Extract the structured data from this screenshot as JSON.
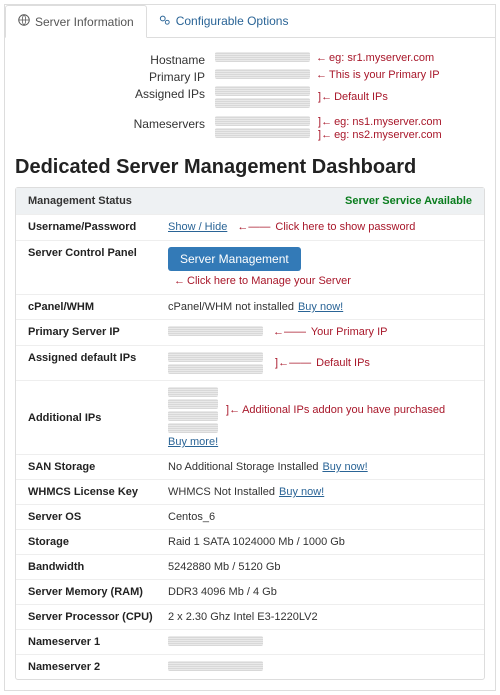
{
  "tabs": {
    "server_info": "Server Information",
    "config_options": "Configurable Options"
  },
  "fields": {
    "hostname": {
      "label": "Hostname",
      "annot": "eg: sr1.myserver.com"
    },
    "primary_ip": {
      "label": "Primary IP",
      "annot": "This is your Primary IP"
    },
    "assigned_ips": {
      "label": "Assigned IPs",
      "annot": "Default IPs"
    },
    "nameservers": {
      "label": "Nameservers",
      "annot1": "eg: ns1.myserver.com",
      "annot2": "eg: ns2.myserver.com"
    }
  },
  "title": "Dedicated Server Management Dashboard",
  "panel": {
    "mgmt_status": "Management Status",
    "service_avail": "Server Service Available"
  },
  "rows": {
    "userpass": {
      "k": "Username/Password",
      "link": "Show / Hide",
      "annot": "Click here to show password"
    },
    "scp": {
      "k": "Server Control Panel",
      "btn": "Server Management",
      "annot": "Click here to Manage your Server"
    },
    "cpanel": {
      "k": "cPanel/WHM",
      "text": "cPanel/WHM not installed",
      "link": "Buy now!"
    },
    "psip": {
      "k": "Primary Server IP",
      "annot": "Your Primary IP"
    },
    "adip": {
      "k": "Assigned default IPs",
      "annot": "Default IPs"
    },
    "addip": {
      "k": "Additional IPs",
      "annot": "Additional IPs addon you have purchased",
      "link": "Buy more!"
    },
    "san": {
      "k": "SAN Storage",
      "text": "No Additional Storage Installed",
      "link": "Buy now!"
    },
    "whmcs": {
      "k": "WHMCS License Key",
      "text": "WHMCS Not Installed",
      "link": "Buy now!"
    },
    "os": {
      "k": "Server OS",
      "v": "Centos_6"
    },
    "storage": {
      "k": "Storage",
      "v": "Raid 1 SATA 1024000 Mb / 1000 Gb"
    },
    "bw": {
      "k": "Bandwidth",
      "v": "5242880 Mb / 5120 Gb"
    },
    "ram": {
      "k": "Server Memory (RAM)",
      "v": "DDR3 4096 Mb / 4 Gb"
    },
    "cpu": {
      "k": "Server Processor (CPU)",
      "v": "2 x 2.30 Ghz Intel E3-1220LV2"
    },
    "ns1": {
      "k": "Nameserver 1"
    },
    "ns2": {
      "k": "Nameserver 2"
    }
  }
}
